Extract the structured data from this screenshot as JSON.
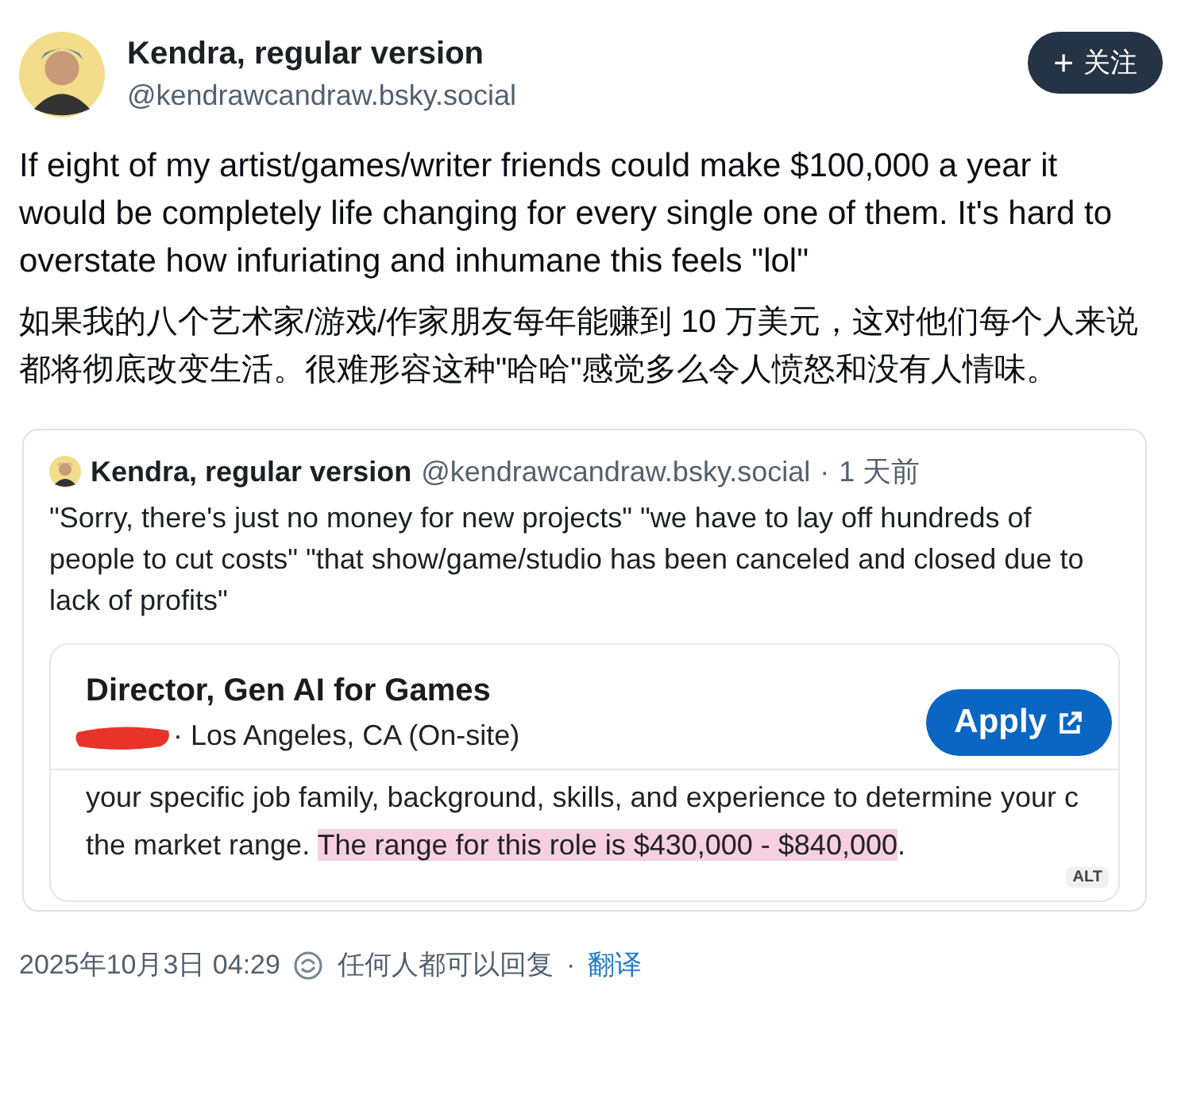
{
  "author": {
    "display_name": "Kendra, regular version",
    "handle": "@kendrawcandraw.bsky.social"
  },
  "follow_button": {
    "icon": "+",
    "label": "关注"
  },
  "post_text": "If eight of my artist/games/writer friends could make $100,000 a year it would be completely life changing for every single one of them. It's hard to overstate how infuriating and inhumane this feels \"lol\"",
  "translation": "如果我的八个艺术家/游戏/作家朋友每年能赚到 10 万美元，这对他们每个人来说都将彻底改变生活。很难形容这种\"哈哈\"感觉多么令人愤怒和没有人情味。",
  "quote": {
    "display_name": "Kendra, regular version",
    "handle": "@kendrawcandraw.bsky.social",
    "separator": "·",
    "time": "1 天前",
    "text": "\"Sorry, there's just no money for new projects\" \"we have to lay off hundreds of people to cut costs\" \"that show/game/studio has been canceled and closed due to lack of profits\"",
    "image": {
      "job_title": "Director, Gen AI for Games",
      "location": "· Los Angeles, CA (On-site)",
      "apply_label": "Apply",
      "line_1": "your specific job family, background, skills, and experience to determine your c",
      "line_2_before": "the market range. ",
      "line_2_highlight": "The range for this role is $430,000 - $840,000",
      "line_2_after": ".",
      "alt_badge": "ALT"
    }
  },
  "footer": {
    "timestamp": "2025年10月3日 04:29",
    "reply_setting": "任何人都可以回复",
    "separator": "·",
    "translate_link": "翻译"
  }
}
